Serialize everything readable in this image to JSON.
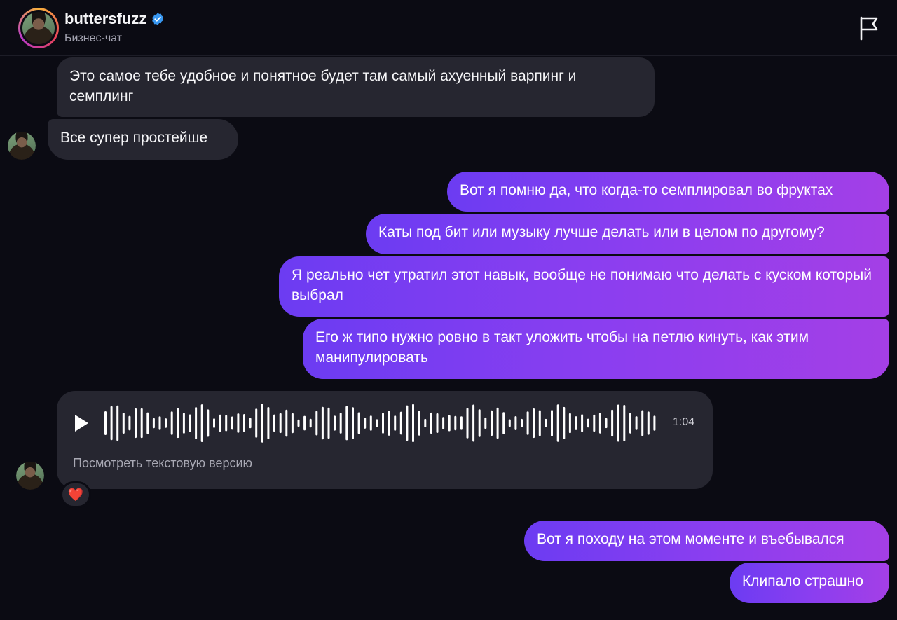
{
  "header": {
    "username": "buttersfuzz",
    "subtitle": "Бизнес-чат",
    "verified_icon": "verified-badge-icon",
    "report_icon": "flag-icon"
  },
  "messages": [
    {
      "direction": "incoming",
      "text": "Это самое тебе удобное и понятное будет там самый ахуенный варпинг и семплинг"
    },
    {
      "direction": "incoming",
      "text": "Все супер простейше"
    },
    {
      "direction": "outgoing",
      "text": "Вот я помню да, что когда-то семплировал во фруктах"
    },
    {
      "direction": "outgoing",
      "text": "Каты под бит или музыку лучше делать или в целом по другому?"
    },
    {
      "direction": "outgoing",
      "text": "Я реально чет утратил этот навык, вообще не понимаю что делать с куском который выбрал"
    },
    {
      "direction": "outgoing",
      "text": "Его ж типо нужно ровно в такт уложить чтобы на петлю кинуть, как этим манипулировать"
    },
    {
      "direction": "outgoing",
      "text": "Вот я походу на этом моменте и въебывался"
    },
    {
      "direction": "outgoing",
      "text": "Клипало страшно"
    }
  ],
  "voice_message": {
    "duration": "1:04",
    "transcript_link": "Посмотреть текстовую версию",
    "reaction": "❤️"
  },
  "colors": {
    "background": "#0b0b13",
    "incoming_bubble": "#262630",
    "outgoing_gradient_start": "#6c3cf2",
    "outgoing_gradient_end": "#a43fe6",
    "verified": "#3897f0"
  }
}
